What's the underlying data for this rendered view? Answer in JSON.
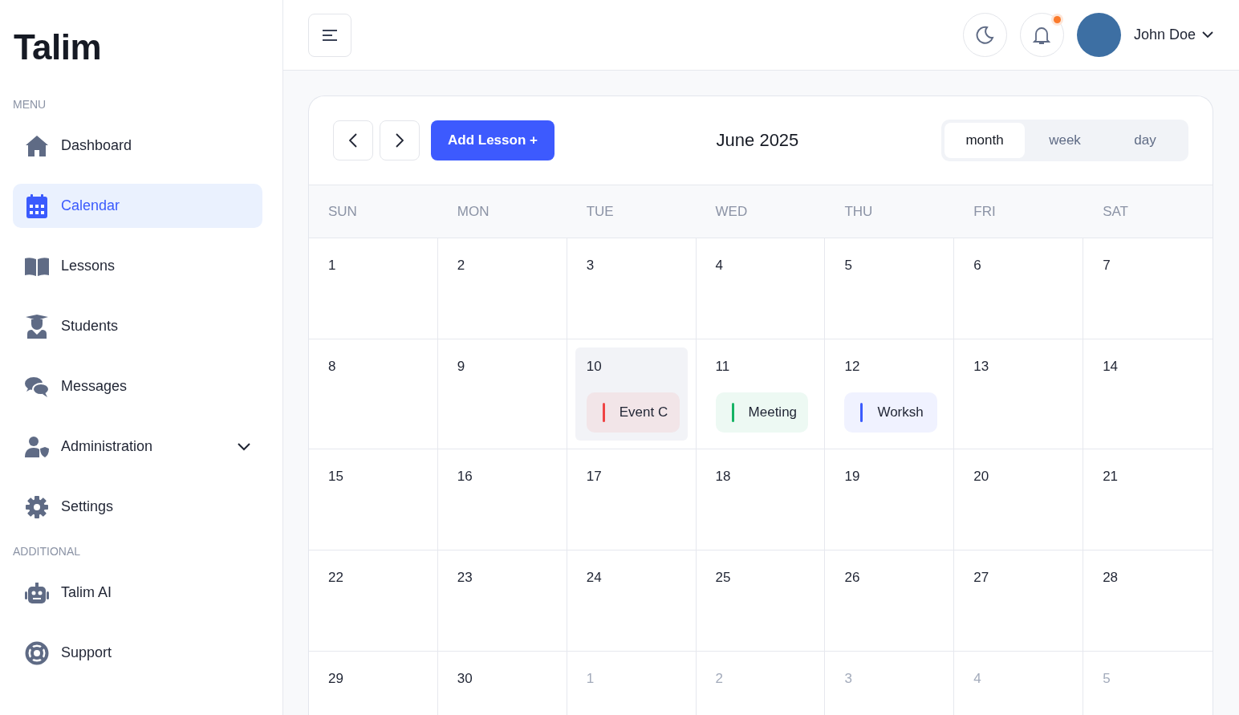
{
  "sidebar": {
    "logo": "Talim",
    "sections": [
      {
        "heading": "MENU",
        "items": [
          {
            "label": "Dashboard",
            "selected": false
          },
          {
            "label": "Calendar",
            "selected": true
          },
          {
            "label": "Lessons",
            "selected": false
          },
          {
            "label": "Students",
            "selected": false
          },
          {
            "label": "Messages",
            "selected": false
          },
          {
            "label": "Administration",
            "selected": false,
            "expanded": false
          },
          {
            "label": "Settings",
            "selected": false
          }
        ]
      },
      {
        "heading": "ADDITIONAL",
        "items": [
          {
            "label": "Talim AI",
            "selected": false
          },
          {
            "label": "Support",
            "selected": false
          }
        ]
      }
    ]
  },
  "header": {
    "notifications": {
      "unread": true
    },
    "user": {
      "name": "John Doe"
    }
  },
  "calendar": {
    "add_button": "Add Lesson +",
    "title": "June 2025",
    "views": [
      {
        "label": "month",
        "selected": true
      },
      {
        "label": "week",
        "selected": false
      },
      {
        "label": "day",
        "selected": false
      }
    ],
    "weekdays": [
      "SUN",
      "MON",
      "TUE",
      "WED",
      "THU",
      "FRI",
      "SAT"
    ],
    "weeks": [
      [
        {
          "day": "1",
          "muted": false,
          "selected": false
        },
        {
          "day": "2",
          "muted": false,
          "selected": false
        },
        {
          "day": "3",
          "muted": false,
          "selected": false
        },
        {
          "day": "4",
          "muted": false,
          "selected": false
        },
        {
          "day": "5",
          "muted": false,
          "selected": false
        },
        {
          "day": "6",
          "muted": false,
          "selected": false
        },
        {
          "day": "7",
          "muted": false,
          "selected": false
        }
      ],
      [
        {
          "day": "8",
          "muted": false,
          "selected": false
        },
        {
          "day": "9",
          "muted": false,
          "selected": false
        },
        {
          "day": "10",
          "muted": false,
          "selected": true,
          "events": [
            {
              "title": "Event C",
              "color": "#ef4444"
            }
          ]
        },
        {
          "day": "11",
          "muted": false,
          "selected": false,
          "events": [
            {
              "title": "Meeting",
              "color": "#16b364"
            }
          ]
        },
        {
          "day": "12",
          "muted": false,
          "selected": false,
          "events": [
            {
              "title": "Worksh",
              "color": "#3b5bfd"
            }
          ]
        },
        {
          "day": "13",
          "muted": false,
          "selected": false
        },
        {
          "day": "14",
          "muted": false,
          "selected": false
        }
      ],
      [
        {
          "day": "15",
          "muted": false,
          "selected": false
        },
        {
          "day": "16",
          "muted": false,
          "selected": false
        },
        {
          "day": "17",
          "muted": false,
          "selected": false
        },
        {
          "day": "18",
          "muted": false,
          "selected": false
        },
        {
          "day": "19",
          "muted": false,
          "selected": false
        },
        {
          "day": "20",
          "muted": false,
          "selected": false
        },
        {
          "day": "21",
          "muted": false,
          "selected": false
        }
      ],
      [
        {
          "day": "22",
          "muted": false,
          "selected": false
        },
        {
          "day": "23",
          "muted": false,
          "selected": false
        },
        {
          "day": "24",
          "muted": false,
          "selected": false
        },
        {
          "day": "25",
          "muted": false,
          "selected": false
        },
        {
          "day": "26",
          "muted": false,
          "selected": false
        },
        {
          "day": "27",
          "muted": false,
          "selected": false
        },
        {
          "day": "28",
          "muted": false,
          "selected": false
        }
      ],
      [
        {
          "day": "29",
          "muted": false,
          "selected": false
        },
        {
          "day": "30",
          "muted": false,
          "selected": false
        },
        {
          "day": "1",
          "muted": true,
          "selected": false
        },
        {
          "day": "2",
          "muted": true,
          "selected": false
        },
        {
          "day": "3",
          "muted": true,
          "selected": false
        },
        {
          "day": "4",
          "muted": true,
          "selected": false
        },
        {
          "day": "5",
          "muted": true,
          "selected": false
        }
      ]
    ]
  }
}
